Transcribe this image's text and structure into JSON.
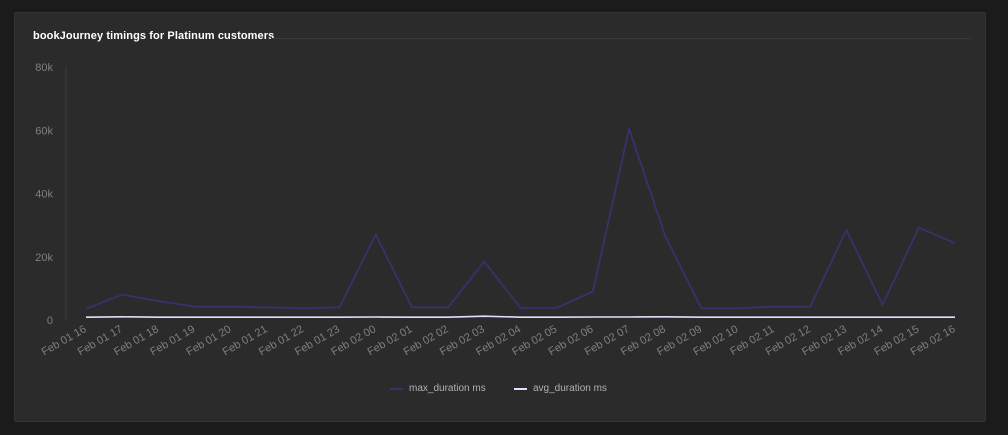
{
  "panel": {
    "title": "bookJourney timings for Platinum customers"
  },
  "chart_data": {
    "type": "line",
    "title": "bookJourney timings for Platinum customers",
    "xlabel": "",
    "ylabel": "",
    "categories": [
      "Feb 01 16",
      "Feb 01 17",
      "Feb 01 18",
      "Feb 01 19",
      "Feb 01 20",
      "Feb 01 21",
      "Feb 01 22",
      "Feb 01 23",
      "Feb 02 00",
      "Feb 02 01",
      "Feb 02 02",
      "Feb 02 03",
      "Feb 02 04",
      "Feb 02 05",
      "Feb 02 06",
      "Feb 02 07",
      "Feb 02 08",
      "Feb 02 09",
      "Feb 02 10",
      "Feb 02 11",
      "Feb 02 12",
      "Feb 02 13",
      "Feb 02 14",
      "Feb 02 15",
      "Feb 02 16"
    ],
    "y_ticks": [
      0,
      20000,
      40000,
      60000,
      80000
    ],
    "y_tick_labels": [
      "0",
      "20k",
      "40k",
      "60k",
      "80k"
    ],
    "ylim": [
      0,
      80000
    ],
    "grid": false,
    "legend_position": "bottom-center",
    "series": [
      {
        "name": "max_duration ms",
        "color": "#3e2e6b",
        "values": [
          3500,
          8000,
          6000,
          4200,
          4200,
          4000,
          3700,
          4000,
          27000,
          4000,
          4000,
          18500,
          3800,
          3800,
          9000,
          60500,
          26500,
          3700,
          3700,
          4200,
          4200,
          28500,
          4800,
          29200,
          24300
        ]
      },
      {
        "name": "avg_duration ms",
        "color": "#e6dcff",
        "values": [
          900,
          1000,
          900,
          900,
          900,
          900,
          900,
          900,
          950,
          900,
          900,
          1200,
          900,
          900,
          950,
          950,
          1000,
          900,
          900,
          900,
          900,
          900,
          900,
          900,
          900
        ]
      }
    ]
  }
}
